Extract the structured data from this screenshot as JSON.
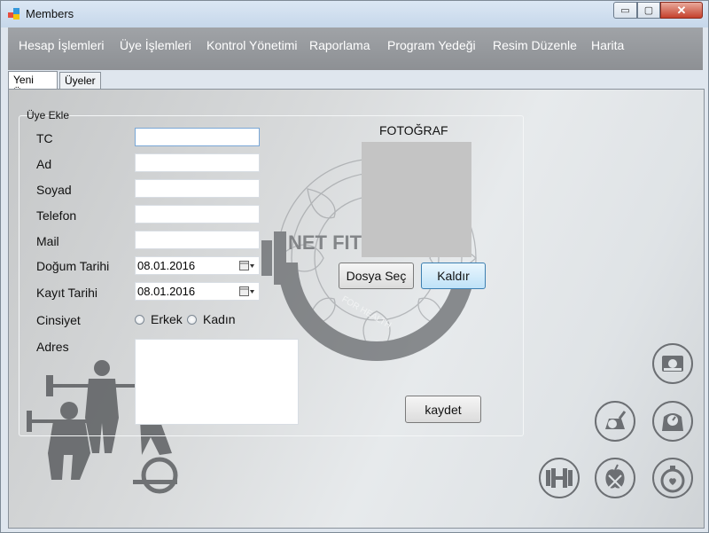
{
  "window": {
    "title": "Members",
    "controls": {
      "minimize": "▭",
      "maximize": "▢",
      "close": "✕"
    }
  },
  "menu": [
    "Hesap İşlemleri",
    "Üye İşlemleri",
    "Kontrol Yönetimi",
    "Raporlama",
    "Program Yedeği",
    "Resim Düzenle",
    "Harita"
  ],
  "tabs": [
    "Yeni Üye",
    "Üyeler"
  ],
  "group": {
    "title": "Üye Ekle"
  },
  "form": {
    "tc_label": "TC",
    "ad_label": "Ad",
    "soyad_label": "Soyad",
    "telefon_label": "Telefon",
    "mail_label": "Mail",
    "dogum_label": "Doğum Tarihi",
    "dogum_value": "08.01.2016",
    "kayit_label": "Kayıt Tarihi",
    "kayit_value": "08.01.2016",
    "cinsiyet_label": "Cinsiyet",
    "erkek_label": "Erkek",
    "kadin_label": "Kadın",
    "adres_label": "Adres"
  },
  "photo": {
    "label": "FOTOĞRAF"
  },
  "buttons": {
    "dosya_sec": "Dosya Seç",
    "kaldir": "Kaldır",
    "kaydet": "kaydet"
  },
  "logo": {
    "text1": "NET FITN",
    "text2": "FOR HEALTH"
  },
  "icons": [
    "tape-measure-icon",
    "scale-icon",
    "weight-scale-icon",
    "dumbbell-icon",
    "diet-icon",
    "stopwatch-icon"
  ]
}
